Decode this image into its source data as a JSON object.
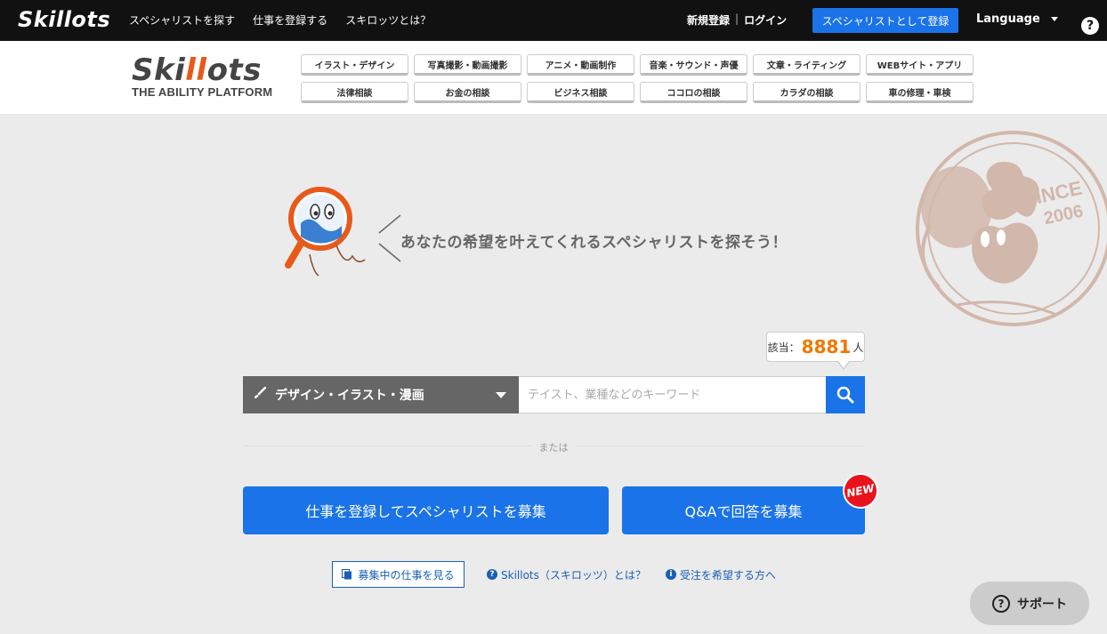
{
  "topbar": {
    "logo": "Skillots",
    "nav": [
      "スペシャリストを探す",
      "仕事を登録する",
      "スキロッツとは？"
    ],
    "signup": "新規登録",
    "auth_sep": "|",
    "login": "ログイン",
    "register_specialist": "スペシャリストとして登録",
    "language": "Language",
    "help": "?"
  },
  "header": {
    "brand_pre": "Ski",
    "brand_ll": "ll",
    "brand_post": "ots",
    "brand_tagline": "THE ABILITY PLATFORM",
    "categories": [
      "イラスト・デザイン",
      "写真撮影・動画撮影",
      "アニメ・動画制作",
      "音楽・サウンド・声優",
      "文章・ライティング",
      "WEBサイト・アプリ",
      "法律相談",
      "お金の相談",
      "ビジネス相談",
      "ココロの相談",
      "カラダの相談",
      "車の修理・車検"
    ]
  },
  "hero": {
    "tagline": "あなたの希望を叶えてくれるスペシャリストを探そう！",
    "stamp_line1": "SINCE",
    "stamp_line2": "2006"
  },
  "search": {
    "count_prefix": "該当：",
    "count": "8881",
    "count_suffix": "人",
    "category": "デザイン・イラスト・漫画",
    "placeholder": "テイスト、業種などのキーワード"
  },
  "divider": {
    "label": "または"
  },
  "cta": {
    "register_job": "仕事を登録してスペシャリストを募集",
    "qa": "Q&Aで回答を募集",
    "new_badge": "NEW"
  },
  "links": {
    "open_jobs": "募集中の仕事を見る",
    "about": "Skillots（スキロッツ）とは？",
    "for_workers": "受注を希望する方へ"
  },
  "support": {
    "label": "サポート",
    "q": "?"
  },
  "colors": {
    "accent": "#1a73e8",
    "orange": "#f07800",
    "badge": "#e8131d"
  }
}
